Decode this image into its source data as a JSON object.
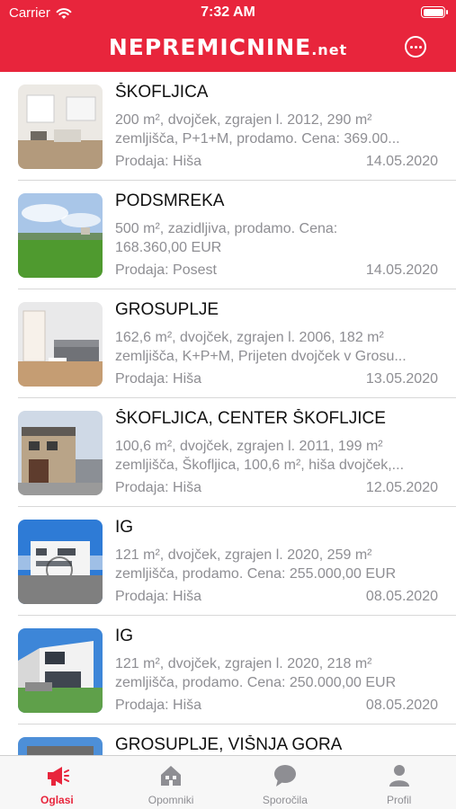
{
  "status": {
    "carrier": "Carrier",
    "time": "7:32 AM"
  },
  "nav": {
    "logo_brand": "NEPREMICNINE",
    "logo_tld": ".net"
  },
  "colors": {
    "accent": "#e8253c",
    "muted": "#8e8e93"
  },
  "listings": [
    {
      "title": "ŠKOFLJICA",
      "desc1": "200 m², dvojček, zgrajen l. 2012, 290 m²",
      "desc2": "zemljišča, P+1+M, prodamo. Cena: 369.00...",
      "type": "Prodaja: Hiša",
      "date": "14.05.2020",
      "thumb": "interior-living-room"
    },
    {
      "title": "PODSMREKA",
      "desc1": "500 m², zazidljiva, prodamo. Cena:",
      "desc2": "168.360,00 EUR",
      "type": "Prodaja: Posest",
      "date": "14.05.2020",
      "thumb": "meadow-land"
    },
    {
      "title": "GROSUPLJE",
      "desc1": "162,6 m², dvojček, zgrajen l. 2006, 182 m²",
      "desc2": "zemljišča, K+P+M, Prijeten dvojček v Grosu...",
      "type": "Prodaja: Hiša",
      "date": "13.05.2020",
      "thumb": "interior-sofa"
    },
    {
      "title": "ŠKOFLJICA, CENTER ŠKOFLJICE",
      "desc1": "100,6 m², dvojček, zgrajen l. 2011, 199 m²",
      "desc2": "zemljišča, Škofljica, 100,6 m², hiša dvojček,...",
      "type": "Prodaja: Hiša",
      "date": "12.05.2020",
      "thumb": "house-exterior"
    },
    {
      "title": "IG",
      "desc1": "121 m², dvojček, zgrajen l. 2020, 259 m²",
      "desc2": "zemljišča, prodamo. Cena: 255.000,00 EUR",
      "type": "Prodaja: Hiša",
      "date": "08.05.2020",
      "thumb": "modern-house"
    },
    {
      "title": "IG",
      "desc1": "121 m², dvojček, zgrajen l. 2020, 218 m²",
      "desc2": "zemljišča, prodamo. Cena: 250.000,00 EUR",
      "type": "Prodaja: Hiša",
      "date": "08.05.2020",
      "thumb": "modern-house-garden"
    },
    {
      "title": "GROSUPLJE, VIŠNJA GORA",
      "desc1": "",
      "desc2": "",
      "type": "",
      "date": "",
      "thumb": "house-partial"
    }
  ],
  "tabs": [
    {
      "label": "Oglasi",
      "icon": "megaphone-icon",
      "active": true
    },
    {
      "label": "Opomniki",
      "icon": "house-icon",
      "active": false
    },
    {
      "label": "Sporočila",
      "icon": "chat-bubble-icon",
      "active": false
    },
    {
      "label": "Profil",
      "icon": "person-icon",
      "active": false
    }
  ]
}
